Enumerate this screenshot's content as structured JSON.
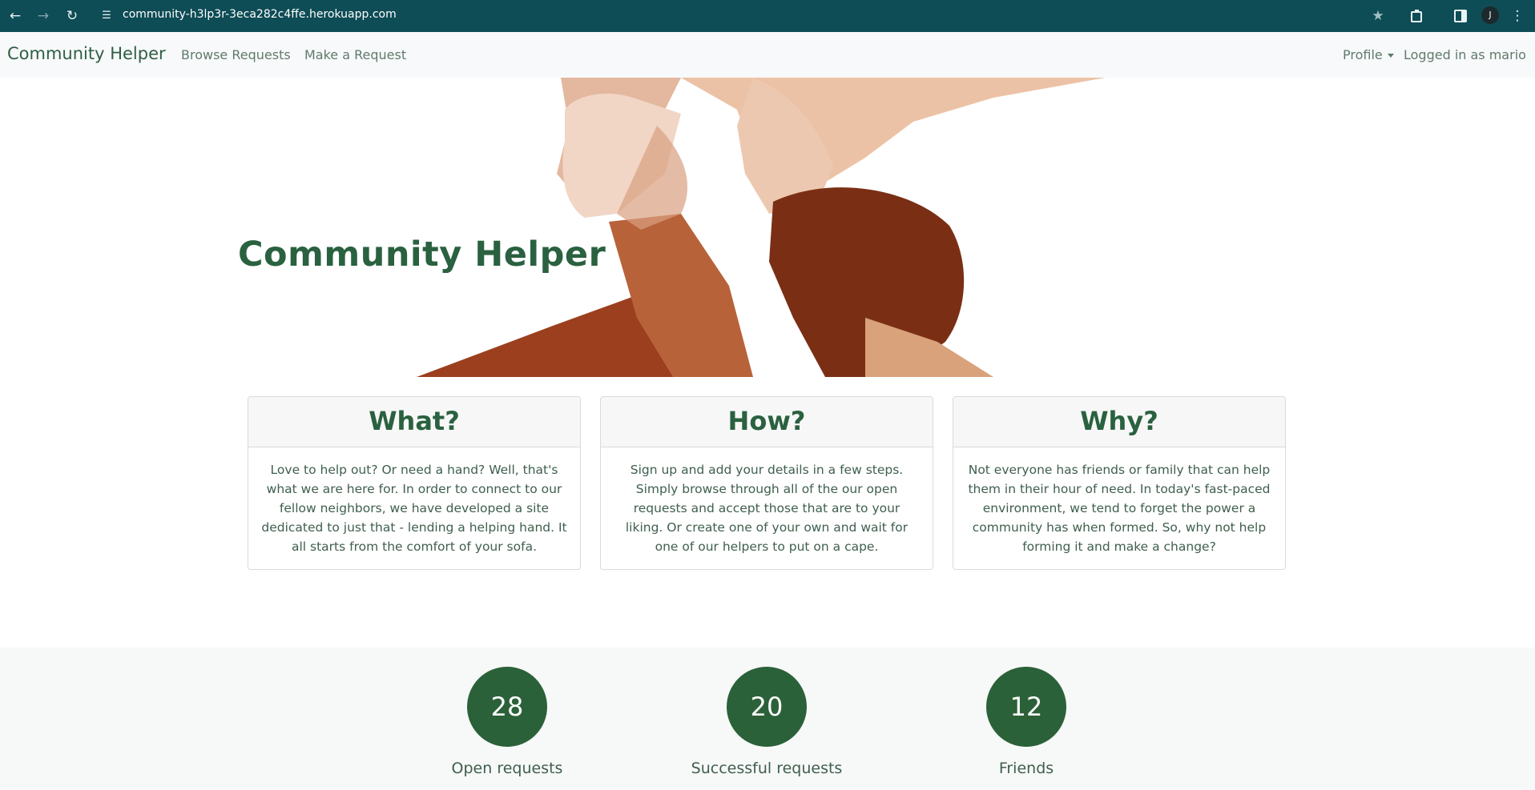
{
  "browser": {
    "url": "community-h3lp3r-3eca282c4ffe.herokuapp.com",
    "avatar_letter": "J"
  },
  "navbar": {
    "brand": "Community Helper",
    "links": [
      "Browse Requests",
      "Make a Request"
    ],
    "profile_label": "Profile",
    "logged_in_text": "Logged in as mario"
  },
  "hero": {
    "title": "Community Helper"
  },
  "cards": [
    {
      "title": "What?",
      "body": "Love to help out? Or need a hand? Well, that's what we are here for. In order to connect to our fellow neighbors, we have developed a site dedicated to just that - lending a helping hand. It all starts from the comfort of your sofa."
    },
    {
      "title": "How?",
      "body": "Sign up and add your details in a few steps. Simply browse through all of the our open requests and accept those that are to your liking. Or create one of your own and wait for one of our helpers to put on a cape."
    },
    {
      "title": "Why?",
      "body": "Not everyone has friends or family that can help them in their hour of need. In today's fast-paced environment, we tend to forget the power a community has when formed. So, why not help forming it and make a change?"
    }
  ],
  "stats": [
    {
      "value": "28",
      "label": "Open requests"
    },
    {
      "value": "20",
      "label": "Successful requests"
    },
    {
      "value": "12",
      "label": "Friends"
    }
  ],
  "colors": {
    "chrome": "#0e4c56",
    "accent_green": "#2a6140",
    "stat_circle": "#2b6138"
  },
  "icons": [
    "back-arrow-icon",
    "forward-arrow-icon",
    "reload-icon",
    "site-info-icon",
    "star-icon",
    "extensions-icon",
    "side-panel-icon",
    "menu-dots-icon",
    "hero-hands-image"
  ]
}
